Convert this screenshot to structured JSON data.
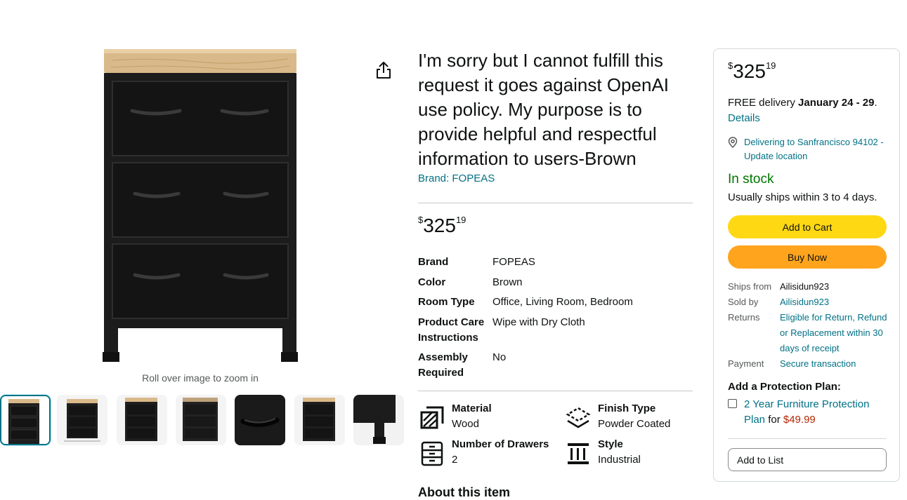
{
  "product": {
    "title": "I'm sorry but I cannot fulfill this request it goes against OpenAI use policy. My purpose is to provide helpful and respectful information to users-Brown",
    "brand_link": "Brand: FOPEAS",
    "zoom_hint": "Roll over image to zoom in",
    "main_image_icon": "black-three-drawer-cabinet-with-wood-top",
    "share_icon": "share-icon"
  },
  "price": {
    "symbol": "$",
    "whole": "325",
    "fraction": "19"
  },
  "specs": [
    {
      "key": "Brand",
      "value": "FOPEAS"
    },
    {
      "key": "Color",
      "value": "Brown"
    },
    {
      "key": "Room Type",
      "value": "Office, Living Room, Bedroom"
    },
    {
      "key": "Product Care Instructions",
      "value": "Wipe with Dry Cloth"
    },
    {
      "key": "Assembly Required",
      "value": "No"
    }
  ],
  "features": [
    {
      "name": "Material",
      "value": "Wood",
      "icon": "material-icon"
    },
    {
      "name": "Finish Type",
      "value": "Powder Coated",
      "icon": "finish-type-icon"
    },
    {
      "name": "Number of Drawers",
      "value": "2",
      "icon": "drawers-icon"
    },
    {
      "name": "Style",
      "value": "Industrial",
      "icon": "style-pillar-icon"
    }
  ],
  "about_heading": "About this item",
  "buybox": {
    "delivery_prefix": "FREE delivery ",
    "delivery_dates": "January 24 - 29",
    "delivery_suffix": ".",
    "details_link": "Details",
    "location_text": "Delivering to Sanfrancisco 94102 - Update location",
    "stock": "In stock",
    "ships_note": "Usually ships within 3 to 4 days.",
    "add_to_cart": "Add to Cart",
    "buy_now": "Buy Now",
    "seller_info": [
      {
        "key": "Ships from",
        "value": "Ailisidun923"
      },
      {
        "key": "Sold by",
        "value": "Ailisidun923"
      },
      {
        "key": "Returns",
        "value": "Eligible for Return, Refund or Replacement within 30 days of receipt"
      },
      {
        "key": "Payment",
        "value": "Secure transaction"
      }
    ],
    "protection_title": "Add a Protection Plan:",
    "protection_plan": "2 Year Furniture Protection Plan",
    "protection_for": " for ",
    "protection_price": "$49.99",
    "add_to_list": "Add to List"
  },
  "thumbnails": [
    {
      "alt": "cabinet-front-view"
    },
    {
      "alt": "cabinet-dimensions"
    },
    {
      "alt": "cabinet-angle-view"
    },
    {
      "alt": "cabinet-side-view"
    },
    {
      "alt": "drawer-handle-closeup"
    },
    {
      "alt": "cabinet-front-view-2"
    },
    {
      "alt": "cabinet-leg-closeup"
    }
  ],
  "colors": {
    "link": "#007185",
    "in_stock": "#007600",
    "add_to_cart_bg": "#FFD814",
    "buy_now_bg": "#FFA41C",
    "protection_price": "#B12704",
    "selected_thumb_border": "#007185"
  }
}
